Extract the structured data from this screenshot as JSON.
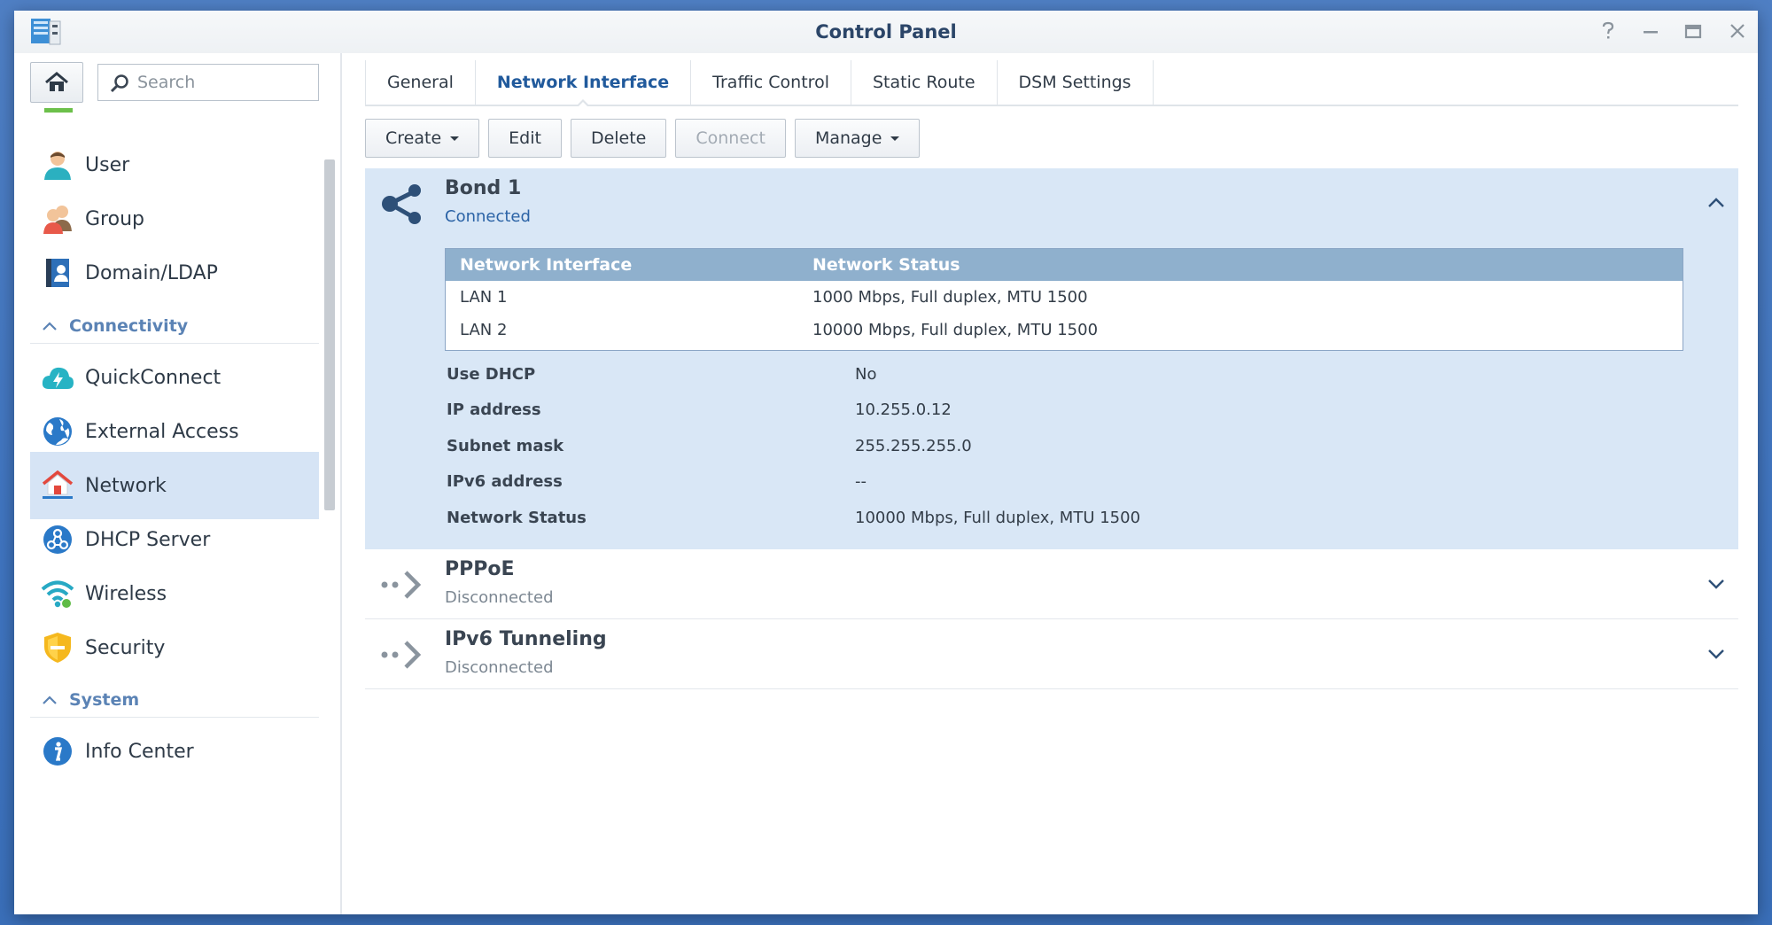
{
  "window": {
    "title": "Control Panel"
  },
  "sidebar": {
    "search_placeholder": "Search",
    "items": [
      {
        "label": "User",
        "icon": "user-icon"
      },
      {
        "label": "Group",
        "icon": "group-icon"
      },
      {
        "label": "Domain/LDAP",
        "icon": "domain-ldap-icon"
      },
      {
        "label": "QuickConnect",
        "icon": "quickconnect-icon"
      },
      {
        "label": "External Access",
        "icon": "globe-icon"
      },
      {
        "label": "Network",
        "icon": "network-house-icon",
        "selected": true
      },
      {
        "label": "DHCP Server",
        "icon": "dhcp-icon"
      },
      {
        "label": "Wireless",
        "icon": "wifi-icon"
      },
      {
        "label": "Security",
        "icon": "shield-icon"
      },
      {
        "label": "Info Center",
        "icon": "info-icon"
      }
    ],
    "sections": {
      "connectivity": "Connectivity",
      "system": "System"
    }
  },
  "tabs": [
    {
      "label": "General"
    },
    {
      "label": "Network Interface",
      "active": true
    },
    {
      "label": "Traffic Control"
    },
    {
      "label": "Static Route"
    },
    {
      "label": "DSM Settings"
    }
  ],
  "toolbar": {
    "create": "Create",
    "edit": "Edit",
    "delete": "Delete",
    "connect": "Connect",
    "manage": "Manage"
  },
  "interfaces": [
    {
      "name": "Bond 1",
      "status": "Connected",
      "expanded": true,
      "table": {
        "headers": [
          "Network Interface",
          "Network Status"
        ],
        "rows": [
          [
            "LAN 1",
            "1000 Mbps, Full duplex, MTU 1500"
          ],
          [
            "LAN 2",
            "10000 Mbps, Full duplex, MTU 1500"
          ]
        ]
      },
      "properties": [
        {
          "key": "Use DHCP",
          "value": "No"
        },
        {
          "key": "IP address",
          "value": "10.255.0.12"
        },
        {
          "key": "Subnet mask",
          "value": "255.255.255.0"
        },
        {
          "key": "IPv6 address",
          "value": "--"
        },
        {
          "key": "Network Status",
          "value": "10000 Mbps, Full duplex, MTU 1500"
        }
      ]
    },
    {
      "name": "PPPoE",
      "status": "Disconnected",
      "expanded": false
    },
    {
      "name": "IPv6 Tunneling",
      "status": "Disconnected",
      "expanded": false
    }
  ],
  "colors": {
    "accent": "#215a9c",
    "selected_bg": "#d6e4f5",
    "expanded_bg": "#d9e7f6",
    "table_header": "#8fb0cd",
    "section_label": "#5b83b5"
  }
}
